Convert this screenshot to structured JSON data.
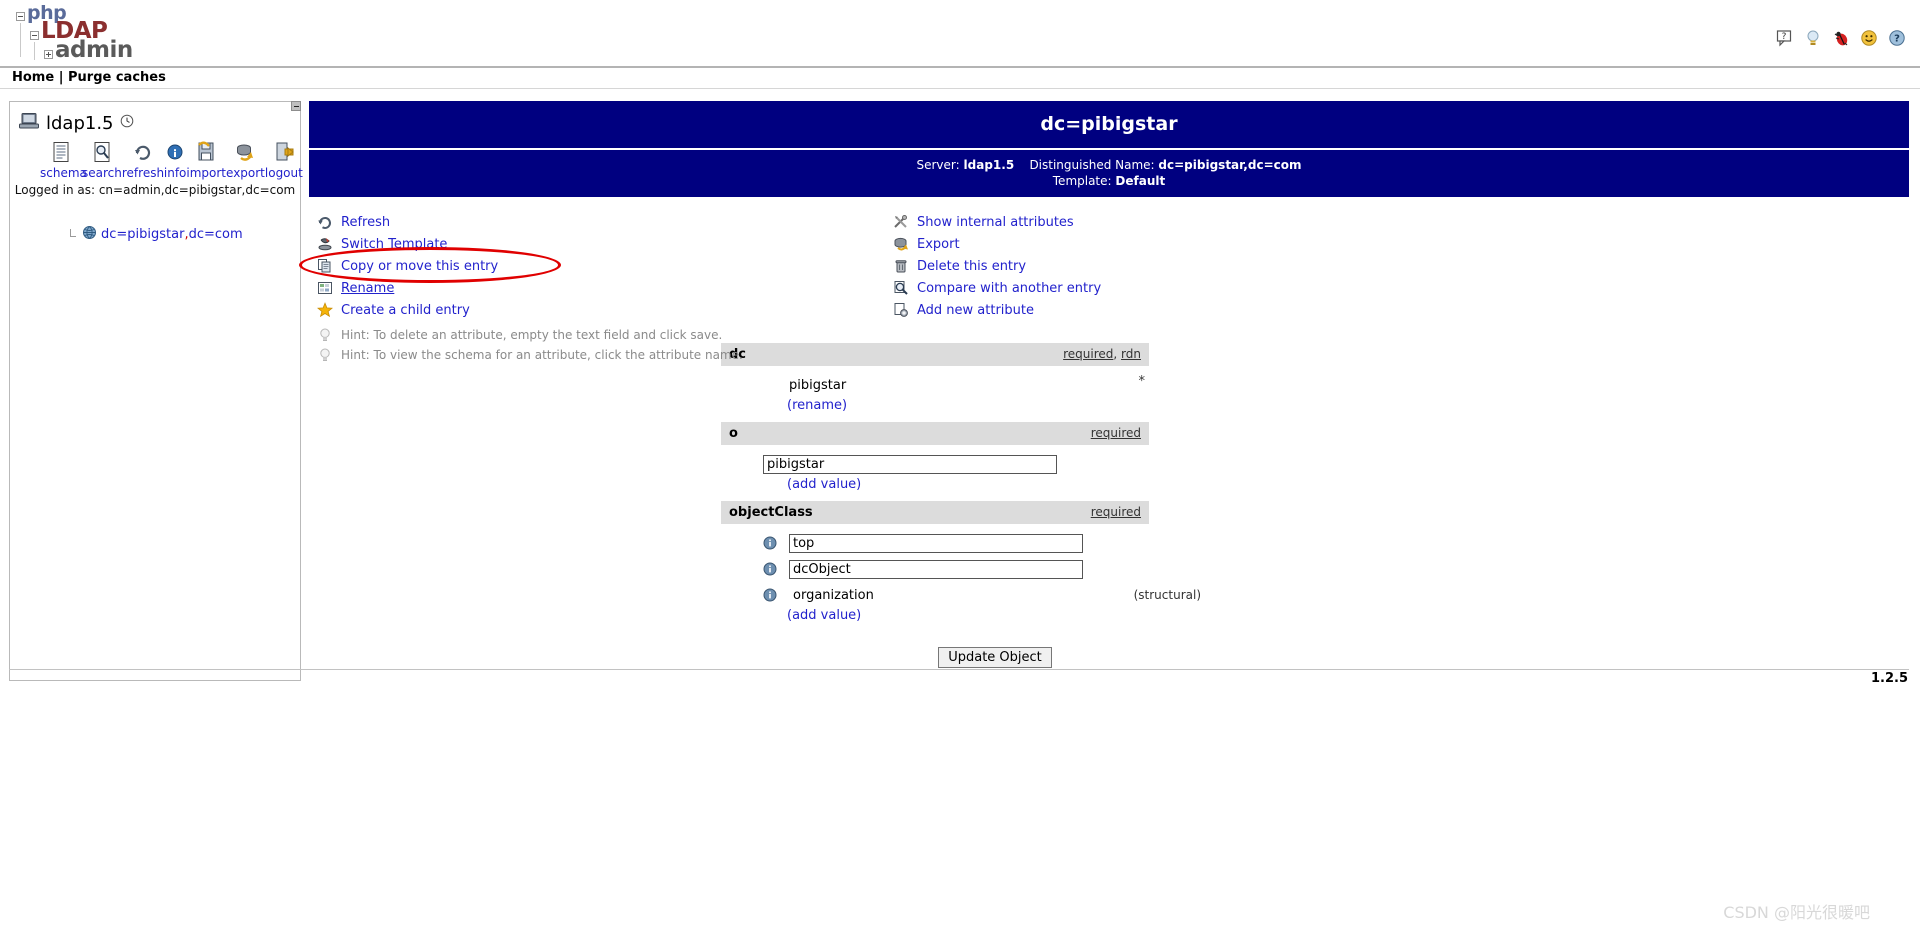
{
  "brand": {
    "part1": "php",
    "part2": "LDAP",
    "part3": "admin"
  },
  "top_icons": [
    {
      "name": "question-bubble-icon",
      "glyph": "?"
    },
    {
      "name": "lightbulb-icon",
      "glyph": "?"
    },
    {
      "name": "bug-icon",
      "glyph": "?"
    },
    {
      "name": "smiley-icon",
      "glyph": "?"
    },
    {
      "name": "help-icon",
      "glyph": "?"
    }
  ],
  "nav": {
    "home": "Home",
    "separator": "|",
    "purge": "Purge caches"
  },
  "sidebar": {
    "server_name": "ldap1.5",
    "tools": [
      {
        "label": "schema",
        "icon": "schema-icon"
      },
      {
        "label": "search",
        "icon": "search-icon"
      },
      {
        "label": "refresh",
        "icon": "refresh-icon"
      },
      {
        "label": "info",
        "icon": "info-icon"
      },
      {
        "label": "import",
        "icon": "import-icon"
      },
      {
        "label": "export",
        "icon": "export-icon"
      },
      {
        "label": "logout",
        "icon": "logout-icon"
      }
    ],
    "logged_in_as": "Logged in as: cn=admin,dc=pibigstar,dc=com",
    "tree_entry": {
      "part1": "dc=pibigstar",
      "comma": ",",
      "part2": "dc=com"
    }
  },
  "entry": {
    "title": "dc=pibigstar",
    "server_label": "Server:",
    "server_value": "ldap1.5",
    "dn_label": "Distinguished Name:",
    "dn_value": "dc=pibigstar,dc=com",
    "template_label": "Template:",
    "template_value": "Default"
  },
  "actions_left": [
    {
      "label": "Refresh",
      "icon": "refresh-icon"
    },
    {
      "label": "Switch Template",
      "icon": "switch-template-icon"
    },
    {
      "label": "Copy or move this entry",
      "icon": "copy-icon"
    },
    {
      "label": "Rename",
      "icon": "rename-icon"
    },
    {
      "label": "Create a child entry",
      "icon": "star-icon"
    }
  ],
  "hints": [
    {
      "icon": "lightbulb-icon",
      "text": "Hint: To delete an attribute, empty the text field and click save."
    },
    {
      "icon": "lightbulb-icon",
      "text": "Hint: To view the schema for an attribute, click the attribute name."
    }
  ],
  "actions_right": [
    {
      "label": "Show internal attributes",
      "icon": "tools-icon"
    },
    {
      "label": "Export",
      "icon": "export-icon"
    },
    {
      "label": "Delete this entry",
      "icon": "trash-icon"
    },
    {
      "label": "Compare with another entry",
      "icon": "compare-icon"
    },
    {
      "label": "Add new attribute",
      "icon": "add-attribute-icon"
    }
  ],
  "attributes": {
    "dc": {
      "name": "dc",
      "flag_required": "required",
      "flag_sep": ", ",
      "flag_rdn": "rdn",
      "value": "pibigstar",
      "star": "*",
      "rename_link": "(rename)"
    },
    "o": {
      "name": "o",
      "flag_required": "required",
      "value": "pibigstar",
      "add_value_link": "(add value)"
    },
    "objectClass": {
      "name": "objectClass",
      "flag_required": "required",
      "values": [
        {
          "value": "top",
          "editable": true
        },
        {
          "value": "dcObject",
          "editable": true
        },
        {
          "value": "organization",
          "editable": false,
          "note": "(structural)"
        }
      ],
      "add_value_link": "(add value)"
    }
  },
  "submit_button": "Update Object",
  "version": "1.2.5",
  "watermark": "CSDN @阳光很暖吧",
  "colors": {
    "header_blue": "#000080",
    "link_blue": "#2222cc",
    "attr_header_gray": "#dcdcdc",
    "annotation_red": "#e00000"
  }
}
